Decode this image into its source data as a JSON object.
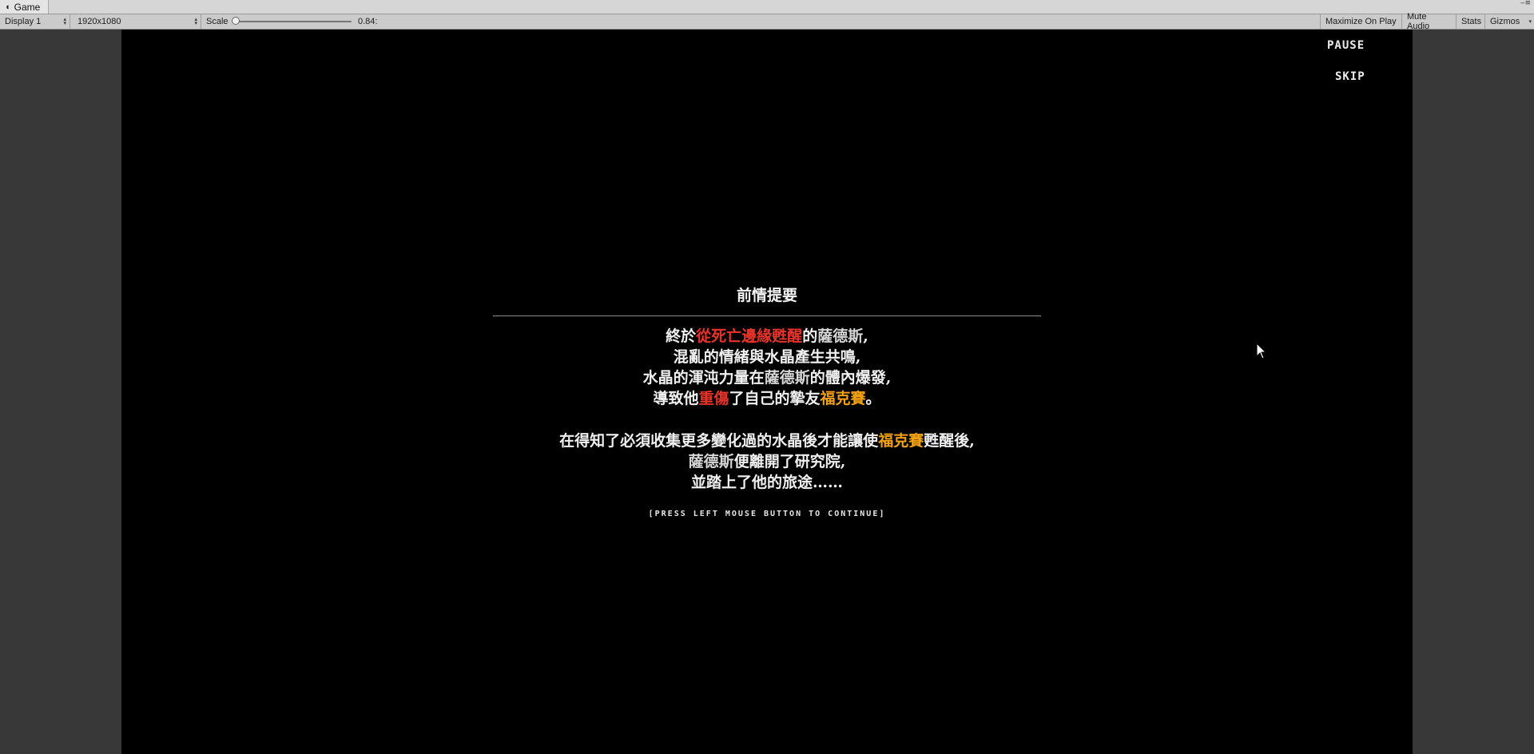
{
  "window": {
    "tab_title": "Game",
    "tab_icon": "camera-icon"
  },
  "toolbar": {
    "display_select": "Display 1",
    "resolution_select": "1920x1080",
    "scale_label": "Scale",
    "scale_value": "0.84:",
    "scale_fraction": 0.0,
    "maximize_on_play": "Maximize On Play",
    "mute_audio": "Mute Audio",
    "stats": "Stats",
    "gizmos": "Gizmos"
  },
  "game": {
    "pause_label": "PAUSE",
    "skip_label": "SKIP",
    "story_title": "前情提要",
    "paragraph1": [
      [
        {
          "t": "終於",
          "c": ""
        },
        {
          "t": "從死亡邊緣甦醒",
          "c": "red"
        },
        {
          "t": "的",
          "c": ""
        },
        {
          "t": "薩德斯",
          "c": "pale"
        },
        {
          "t": ",",
          "c": ""
        }
      ],
      [
        {
          "t": "混亂的情緒與水晶產生共鳴,",
          "c": ""
        }
      ],
      [
        {
          "t": "水晶的渾沌力量在",
          "c": ""
        },
        {
          "t": "薩德斯",
          "c": "pale"
        },
        {
          "t": "的體內爆發,",
          "c": ""
        }
      ],
      [
        {
          "t": "導致他",
          "c": ""
        },
        {
          "t": "重傷",
          "c": "red"
        },
        {
          "t": "了自己的摯友",
          "c": ""
        },
        {
          "t": "福克賽",
          "c": "orange"
        },
        {
          "t": "。",
          "c": ""
        }
      ]
    ],
    "paragraph2": [
      [
        {
          "t": "在得知了必須收集更多變化過的水晶後才能讓使",
          "c": ""
        },
        {
          "t": "福克賽",
          "c": "orange"
        },
        {
          "t": "甦醒後,",
          "c": ""
        }
      ],
      [
        {
          "t": "薩德斯",
          "c": "pale"
        },
        {
          "t": "便離開了研究院,",
          "c": ""
        }
      ],
      [
        {
          "t": "並踏上了他的旅途……",
          "c": ""
        }
      ]
    ],
    "continue_hint": "[PRESS LEFT MOUSE BUTTON TO CONTINUE]"
  },
  "colors": {
    "highlight_red": "#e8332a",
    "highlight_orange": "#f2a014"
  }
}
